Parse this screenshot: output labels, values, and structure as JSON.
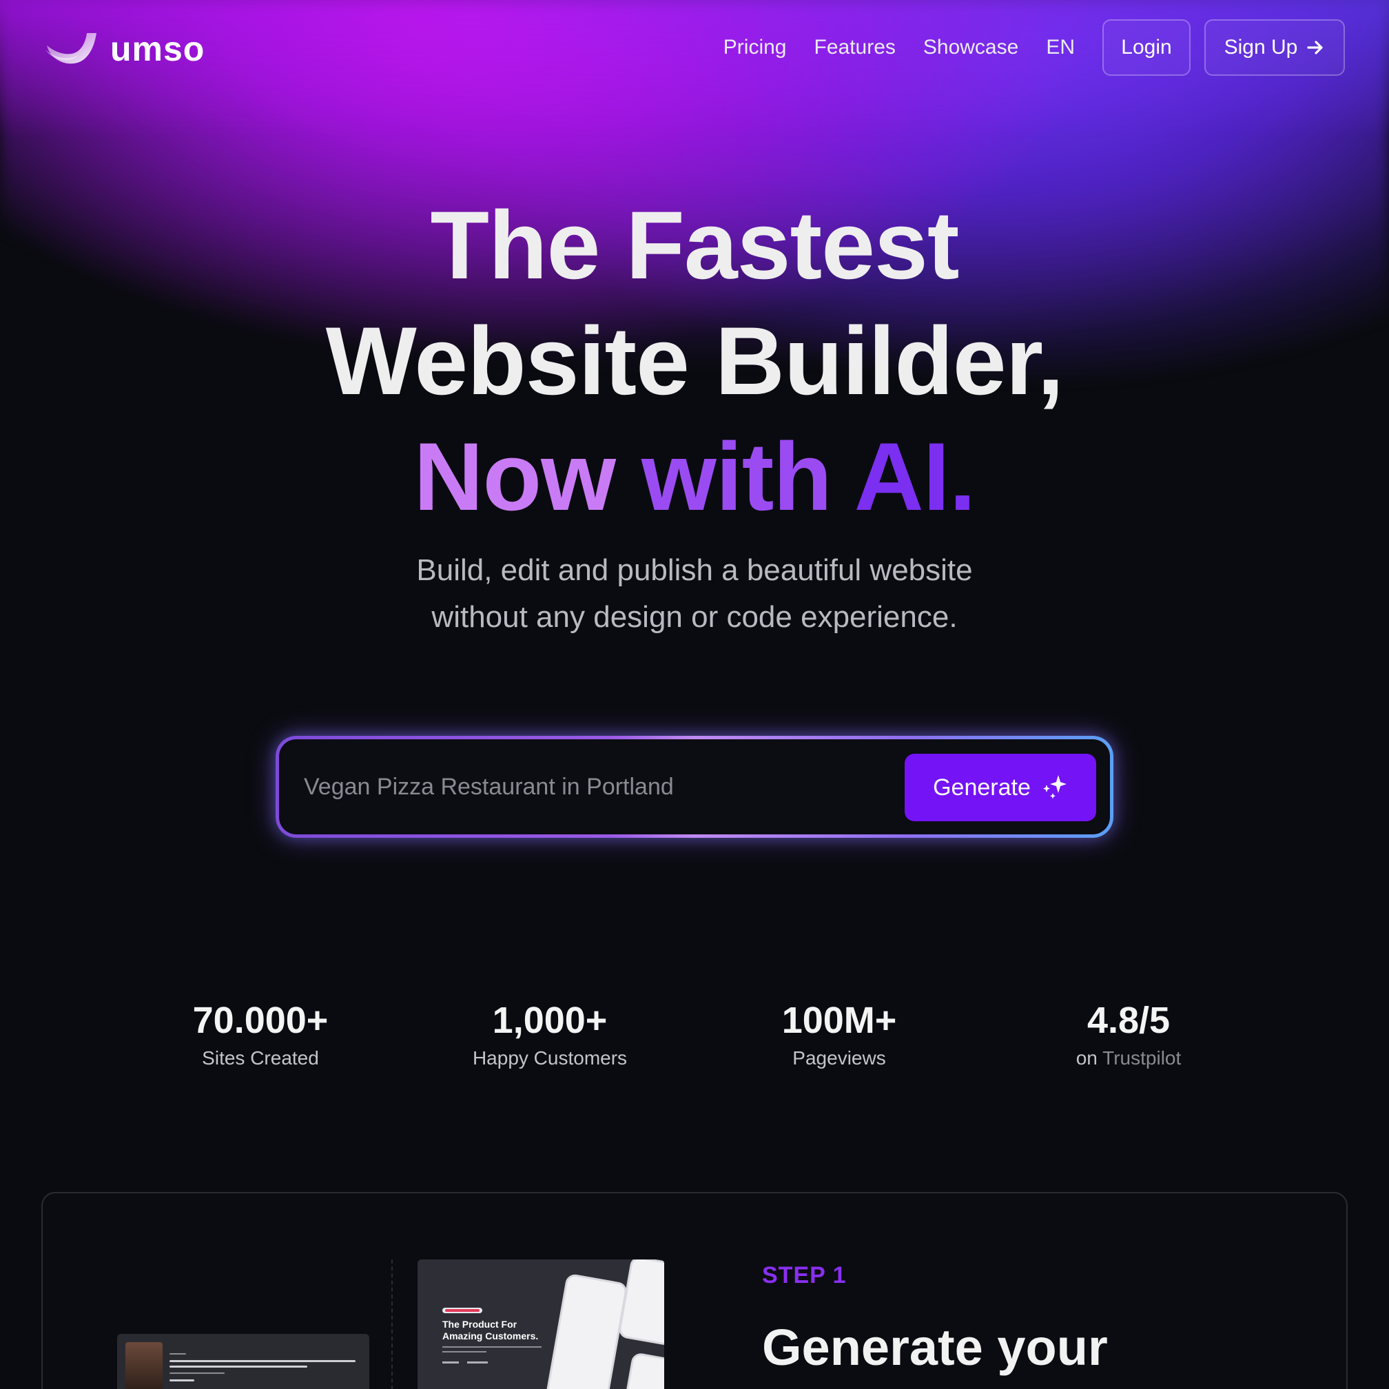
{
  "brand": {
    "name": "umso"
  },
  "nav": {
    "links": [
      "Pricing",
      "Features",
      "Showcase",
      "EN"
    ],
    "login_label": "Login",
    "signup_label": "Sign Up"
  },
  "hero": {
    "title_line1": "The Fastest",
    "title_line2": "Website Builder,",
    "title_ai_1": "Now",
    "title_ai_2": "with",
    "title_ai_3": "AI.",
    "subtitle_line1": "Build, edit and publish a beautiful website",
    "subtitle_line2": "without any design or code experience."
  },
  "generator": {
    "placeholder": "Vegan Pizza Restaurant in Portland",
    "button_label": "Generate",
    "button_icon": "sparkles-icon"
  },
  "stats": [
    {
      "value": "70.000+",
      "label": "Sites Created"
    },
    {
      "value": "1,000+",
      "label": "Happy Customers"
    },
    {
      "value": "100M+",
      "label": "Pageviews"
    },
    {
      "value": "4.8/5",
      "label_prefix": "on",
      "label_link": "Trustpilot"
    }
  ],
  "step": {
    "label": "STEP 1",
    "title": "Generate your",
    "preview_title": "The Product For Amazing Customers."
  },
  "colors": {
    "background": "#0a0b10",
    "accent": "#7413f5",
    "glow_pink": "#c316ef",
    "glow_violet": "#6a33f0",
    "step_label": "#8a2ff2"
  }
}
